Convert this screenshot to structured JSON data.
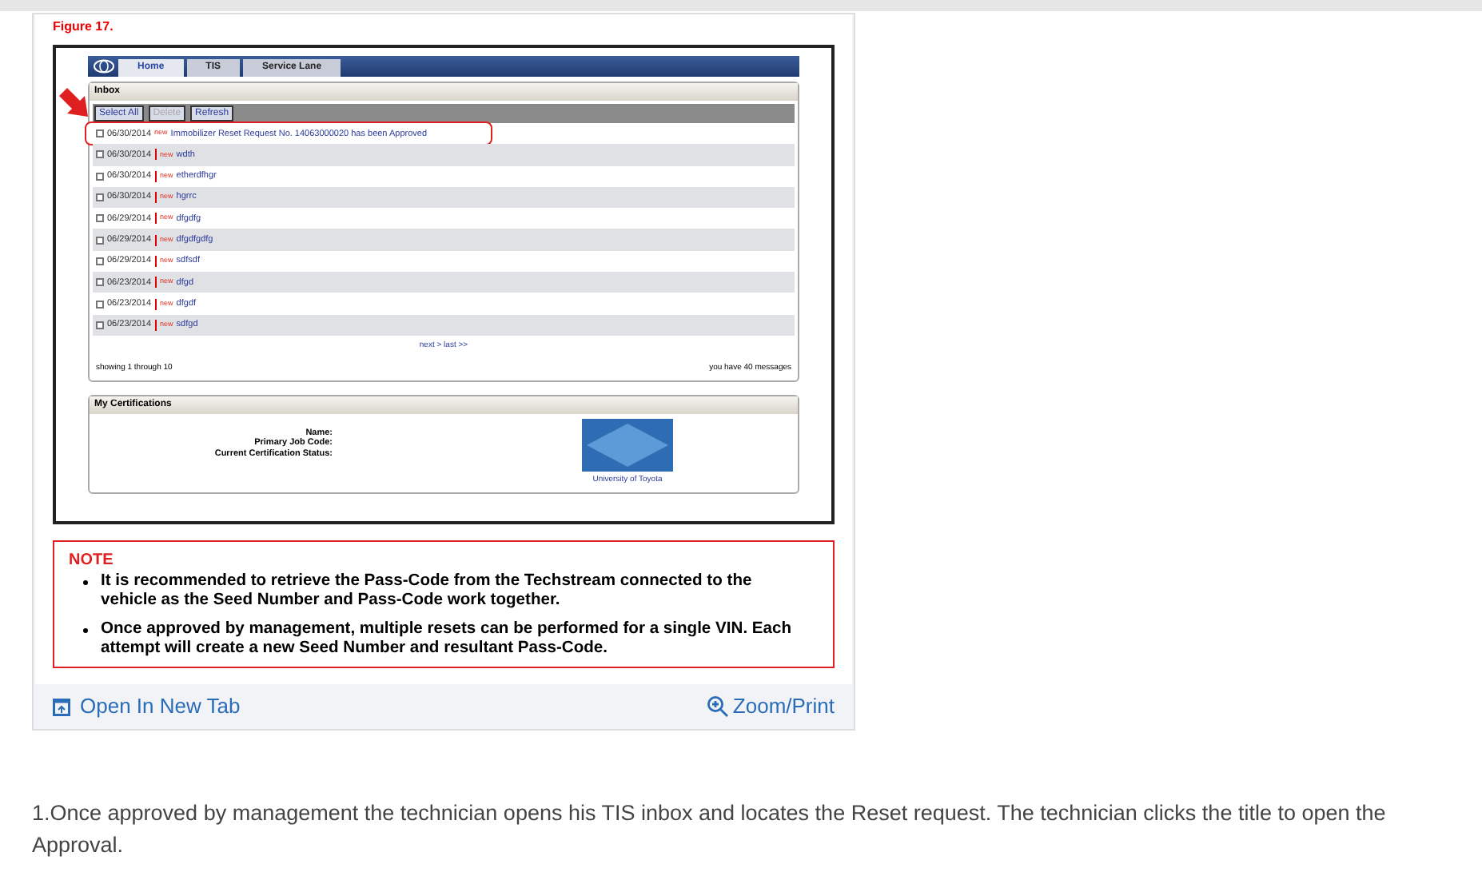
{
  "figure": {
    "caption": "Figure 17.",
    "tabs": [
      {
        "label": "Home",
        "selected": true
      },
      {
        "label": "TIS",
        "selected": false
      },
      {
        "label": "Service Lane",
        "selected": false
      }
    ],
    "inbox": {
      "title": "Inbox",
      "buttons": [
        {
          "label": "Select All",
          "disabled": false
        },
        {
          "label": "Delete",
          "disabled": true
        },
        {
          "label": "Refresh",
          "disabled": false
        }
      ],
      "rows": [
        {
          "date": "06/30/2014",
          "flag": false,
          "badge": "new",
          "subject": "Immobilizer Reset Request No. 14063000020 has been Approved",
          "checked": false,
          "highlighted": true
        },
        {
          "date": "06/30/2014",
          "flag": true,
          "badge": "new",
          "subject": "wdth",
          "checked": false,
          "highlighted": false
        },
        {
          "date": "06/30/2014",
          "flag": true,
          "badge": "new",
          "subject": "etherdfhgr",
          "checked": false,
          "highlighted": false
        },
        {
          "date": "06/30/2014",
          "flag": true,
          "badge": "new",
          "subject": "hgrrc",
          "checked": false,
          "highlighted": false
        },
        {
          "date": "06/29/2014",
          "flag": true,
          "badge": "new",
          "subject": "dfgdfg",
          "checked": false,
          "highlighted": false
        },
        {
          "date": "06/29/2014",
          "flag": true,
          "badge": "new",
          "subject": "dfgdfgdfg",
          "checked": false,
          "highlighted": false
        },
        {
          "date": "06/29/2014",
          "flag": true,
          "badge": "new",
          "subject": "sdfsdf",
          "checked": false,
          "highlighted": false
        },
        {
          "date": "06/23/2014",
          "flag": true,
          "badge": "new",
          "subject": "dfgd",
          "checked": false,
          "highlighted": false
        },
        {
          "date": "06/23/2014",
          "flag": true,
          "badge": "new",
          "subject": "dfgdf",
          "checked": false,
          "highlighted": false
        },
        {
          "date": "06/23/2014",
          "flag": true,
          "badge": "new",
          "subject": "sdfgd",
          "checked": false,
          "highlighted": false
        }
      ],
      "pagination": "next > last >>",
      "showing": "showing 1 through 10",
      "count": "you have 40 messages"
    },
    "certifications": {
      "title": "My Certifications",
      "fields": [
        "Name:",
        "Primary Job Code:",
        "Current Certification Status:"
      ],
      "logo_caption": "University of Toyota"
    }
  },
  "note": {
    "title": "NOTE",
    "bullets": [
      "It is recommended to retrieve the Pass-Code from the Techstream connected to the vehicle as the Seed Number and Pass-Code work together.",
      "Once approved by management, multiple resets can be performed for a single VIN. Each attempt will create a new Seed Number and resultant Pass-Code."
    ]
  },
  "links": {
    "open": "Open In New Tab",
    "zoom": "Zoom/Print"
  },
  "paragraph": "1.Once approved by management the technician opens his TIS inbox and locates the Reset request. The technician clicks the title to open the Approval."
}
